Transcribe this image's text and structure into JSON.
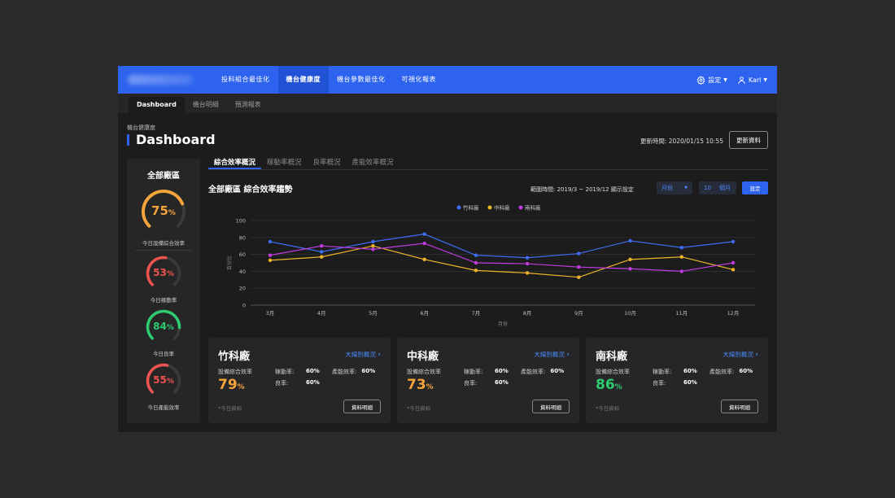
{
  "nav": {
    "items": [
      "投料組合最佳化",
      "機台健康度",
      "機台參數最佳化",
      "可視化報表"
    ],
    "active_index": 1,
    "settings_label": "設定",
    "user_label": "Karl"
  },
  "subtabs": [
    "Dashboard",
    "機台明細",
    "預測報表"
  ],
  "page": {
    "breadcrumb": "機台健康度",
    "title": "Dashboard",
    "updated": "更新時間: 2020/01/15 10:55",
    "refresh_label": "更新資料"
  },
  "left_panel": {
    "title": "全部廠區",
    "gauges": [
      {
        "value": 75,
        "unit": "%",
        "label": "今日設備綜合效率",
        "color": "#f5a33b"
      },
      {
        "value": 53,
        "unit": "%",
        "label": "今日稼動率",
        "color": "#ef5350"
      },
      {
        "value": 84,
        "unit": "%",
        "label": "今日良率",
        "color": "#2ecc71"
      },
      {
        "value": 55,
        "unit": "%",
        "label": "今日產能效率",
        "color": "#ef5350"
      }
    ]
  },
  "main_tabs": [
    "綜合效率概況",
    "稼動率概況",
    "良率概況",
    "產能效率概況"
  ],
  "chart_header": {
    "title": "全部廠區 綜合效率趨勢",
    "range": "範圍時間: 2019/3 ~ 2019/12   顯示設定",
    "unit_select": "月份",
    "count_value": "10",
    "count_unit": "個月",
    "set_label": "設定"
  },
  "chart_data": {
    "type": "line",
    "x": [
      "3月",
      "4月",
      "5月",
      "6月",
      "7月",
      "8月",
      "9月",
      "10月",
      "11月",
      "12月"
    ],
    "xlabel": "月份",
    "ylabel": "百分比",
    "ylim": [
      0,
      100
    ],
    "yticks": [
      0,
      20,
      40,
      60,
      80,
      100
    ],
    "grid": true,
    "legend": "top-center",
    "series": [
      {
        "name": "竹科廠",
        "color": "#3d6ef5",
        "values": [
          75,
          63,
          75,
          84,
          59,
          56,
          61,
          76,
          68,
          75
        ]
      },
      {
        "name": "中科廠",
        "color": "#f0b429",
        "values": [
          53,
          57,
          70,
          54,
          41,
          38,
          33,
          54,
          57,
          42
        ]
      },
      {
        "name": "南科廠",
        "color": "#c13be0",
        "values": [
          59,
          70,
          66,
          73,
          50,
          49,
          45,
          43,
          40,
          50
        ]
      }
    ]
  },
  "cards": [
    {
      "name": "竹科廠",
      "link": "大線別概況",
      "oee_label": "設備綜合效率",
      "oee": "79",
      "unit": "%",
      "oee_color": "#f5a33b",
      "util_label": "稼動率:",
      "util": "60%",
      "cap_label": "產能效率:",
      "cap": "60%",
      "yield_label": "良率:",
      "yield": "60%",
      "note": "*今日資料",
      "btn": "資料明細"
    },
    {
      "name": "中科廠",
      "link": "大線別概況",
      "oee_label": "設備綜合效率",
      "oee": "73",
      "unit": "%",
      "oee_color": "#f5a33b",
      "util_label": "稼動率:",
      "util": "60%",
      "cap_label": "產能效率:",
      "cap": "60%",
      "yield_label": "良率:",
      "yield": "60%",
      "note": "*今日資料",
      "btn": "資料明細"
    },
    {
      "name": "南科廠",
      "link": "大線別概況",
      "oee_label": "設備綜合效率",
      "oee": "86",
      "unit": "%",
      "oee_color": "#2ecc71",
      "util_label": "稼動率:",
      "util": "60%",
      "cap_label": "產能效率:",
      "cap": "60%",
      "yield_label": "良率:",
      "yield": "60%",
      "note": "*今日資料",
      "btn": "資料明細"
    }
  ]
}
